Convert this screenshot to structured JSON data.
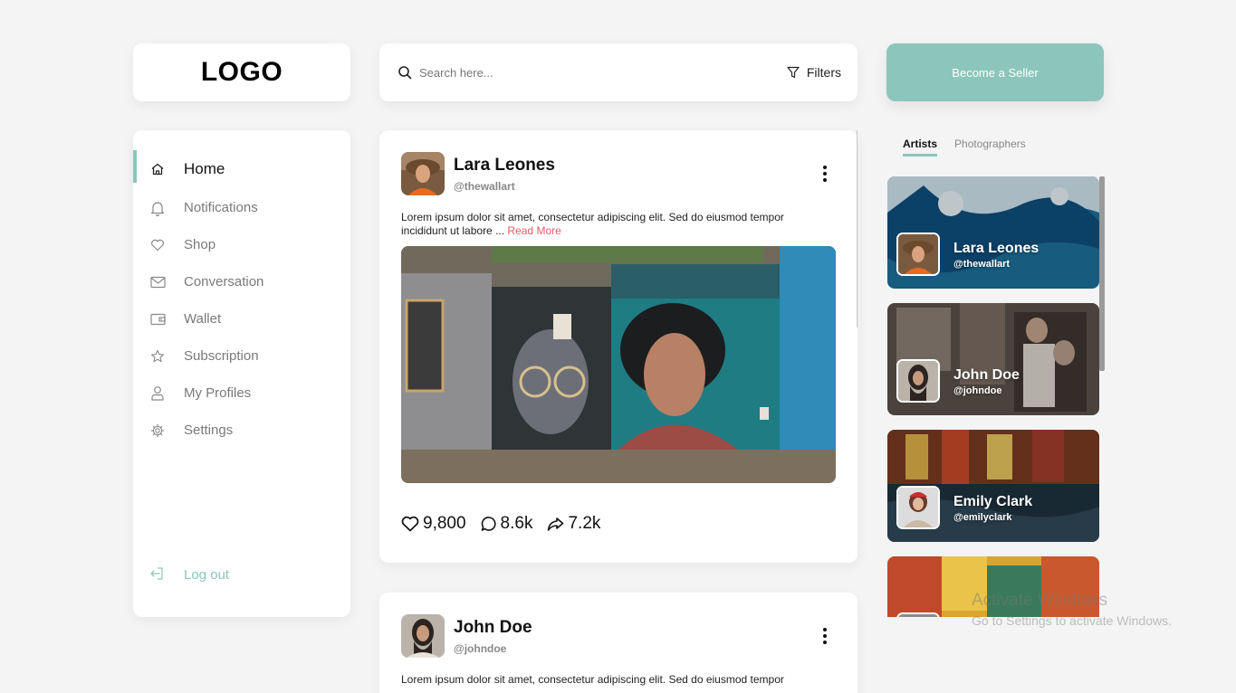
{
  "logo": {
    "text": "LOGO"
  },
  "search": {
    "placeholder": "Search here...",
    "value": "",
    "filters_label": "Filters"
  },
  "header": {
    "seller_button_label": "Become a Seller"
  },
  "sidebar": {
    "items": [
      {
        "label": "Home",
        "icon": "home-icon",
        "active": true
      },
      {
        "label": "Notifications",
        "icon": "bell-icon"
      },
      {
        "label": "Shop",
        "icon": "heart-icon"
      },
      {
        "label": "Conversation",
        "icon": "mail-icon"
      },
      {
        "label": "Wallet",
        "icon": "wallet-icon"
      },
      {
        "label": "Subscription",
        "icon": "star-icon"
      },
      {
        "label": "My Profiles",
        "icon": "user-icon"
      },
      {
        "label": "Settings",
        "icon": "gear-icon"
      }
    ],
    "logout_label": "Log out"
  },
  "feed": {
    "posts": [
      {
        "author": "Lara Leones",
        "handle": "@thewallart",
        "text": "Lorem ipsum dolor sit amet, consectetur adipiscing elit. Sed do eiusmod tempor incididunt ut labore ...",
        "read_more": "Read More",
        "likes": "9,800",
        "comments": "8.6k",
        "shares": "7.2k"
      },
      {
        "author": "John Doe",
        "handle": "@johndoe",
        "text": "Lorem ipsum dolor sit amet, consectetur adipiscing elit. Sed do eiusmod tempor"
      }
    ]
  },
  "right_panel": {
    "tabs": [
      {
        "label": "Artists",
        "active": true
      },
      {
        "label": "Photographers"
      }
    ],
    "artists": [
      {
        "name": "Lara Leones",
        "handle": "@thewallart"
      },
      {
        "name": "John Doe",
        "handle": "@johndoe"
      },
      {
        "name": "Emily Clark",
        "handle": "@emilyclark"
      },
      {
        "name": "",
        "handle": ""
      }
    ]
  },
  "watermark": {
    "title": "Activate Windows",
    "subtitle": "Go to Settings to activate Windows."
  },
  "colors": {
    "accent": "#8cc5bb",
    "read_more": "#e85b6c",
    "background": "#f4f4f4"
  }
}
